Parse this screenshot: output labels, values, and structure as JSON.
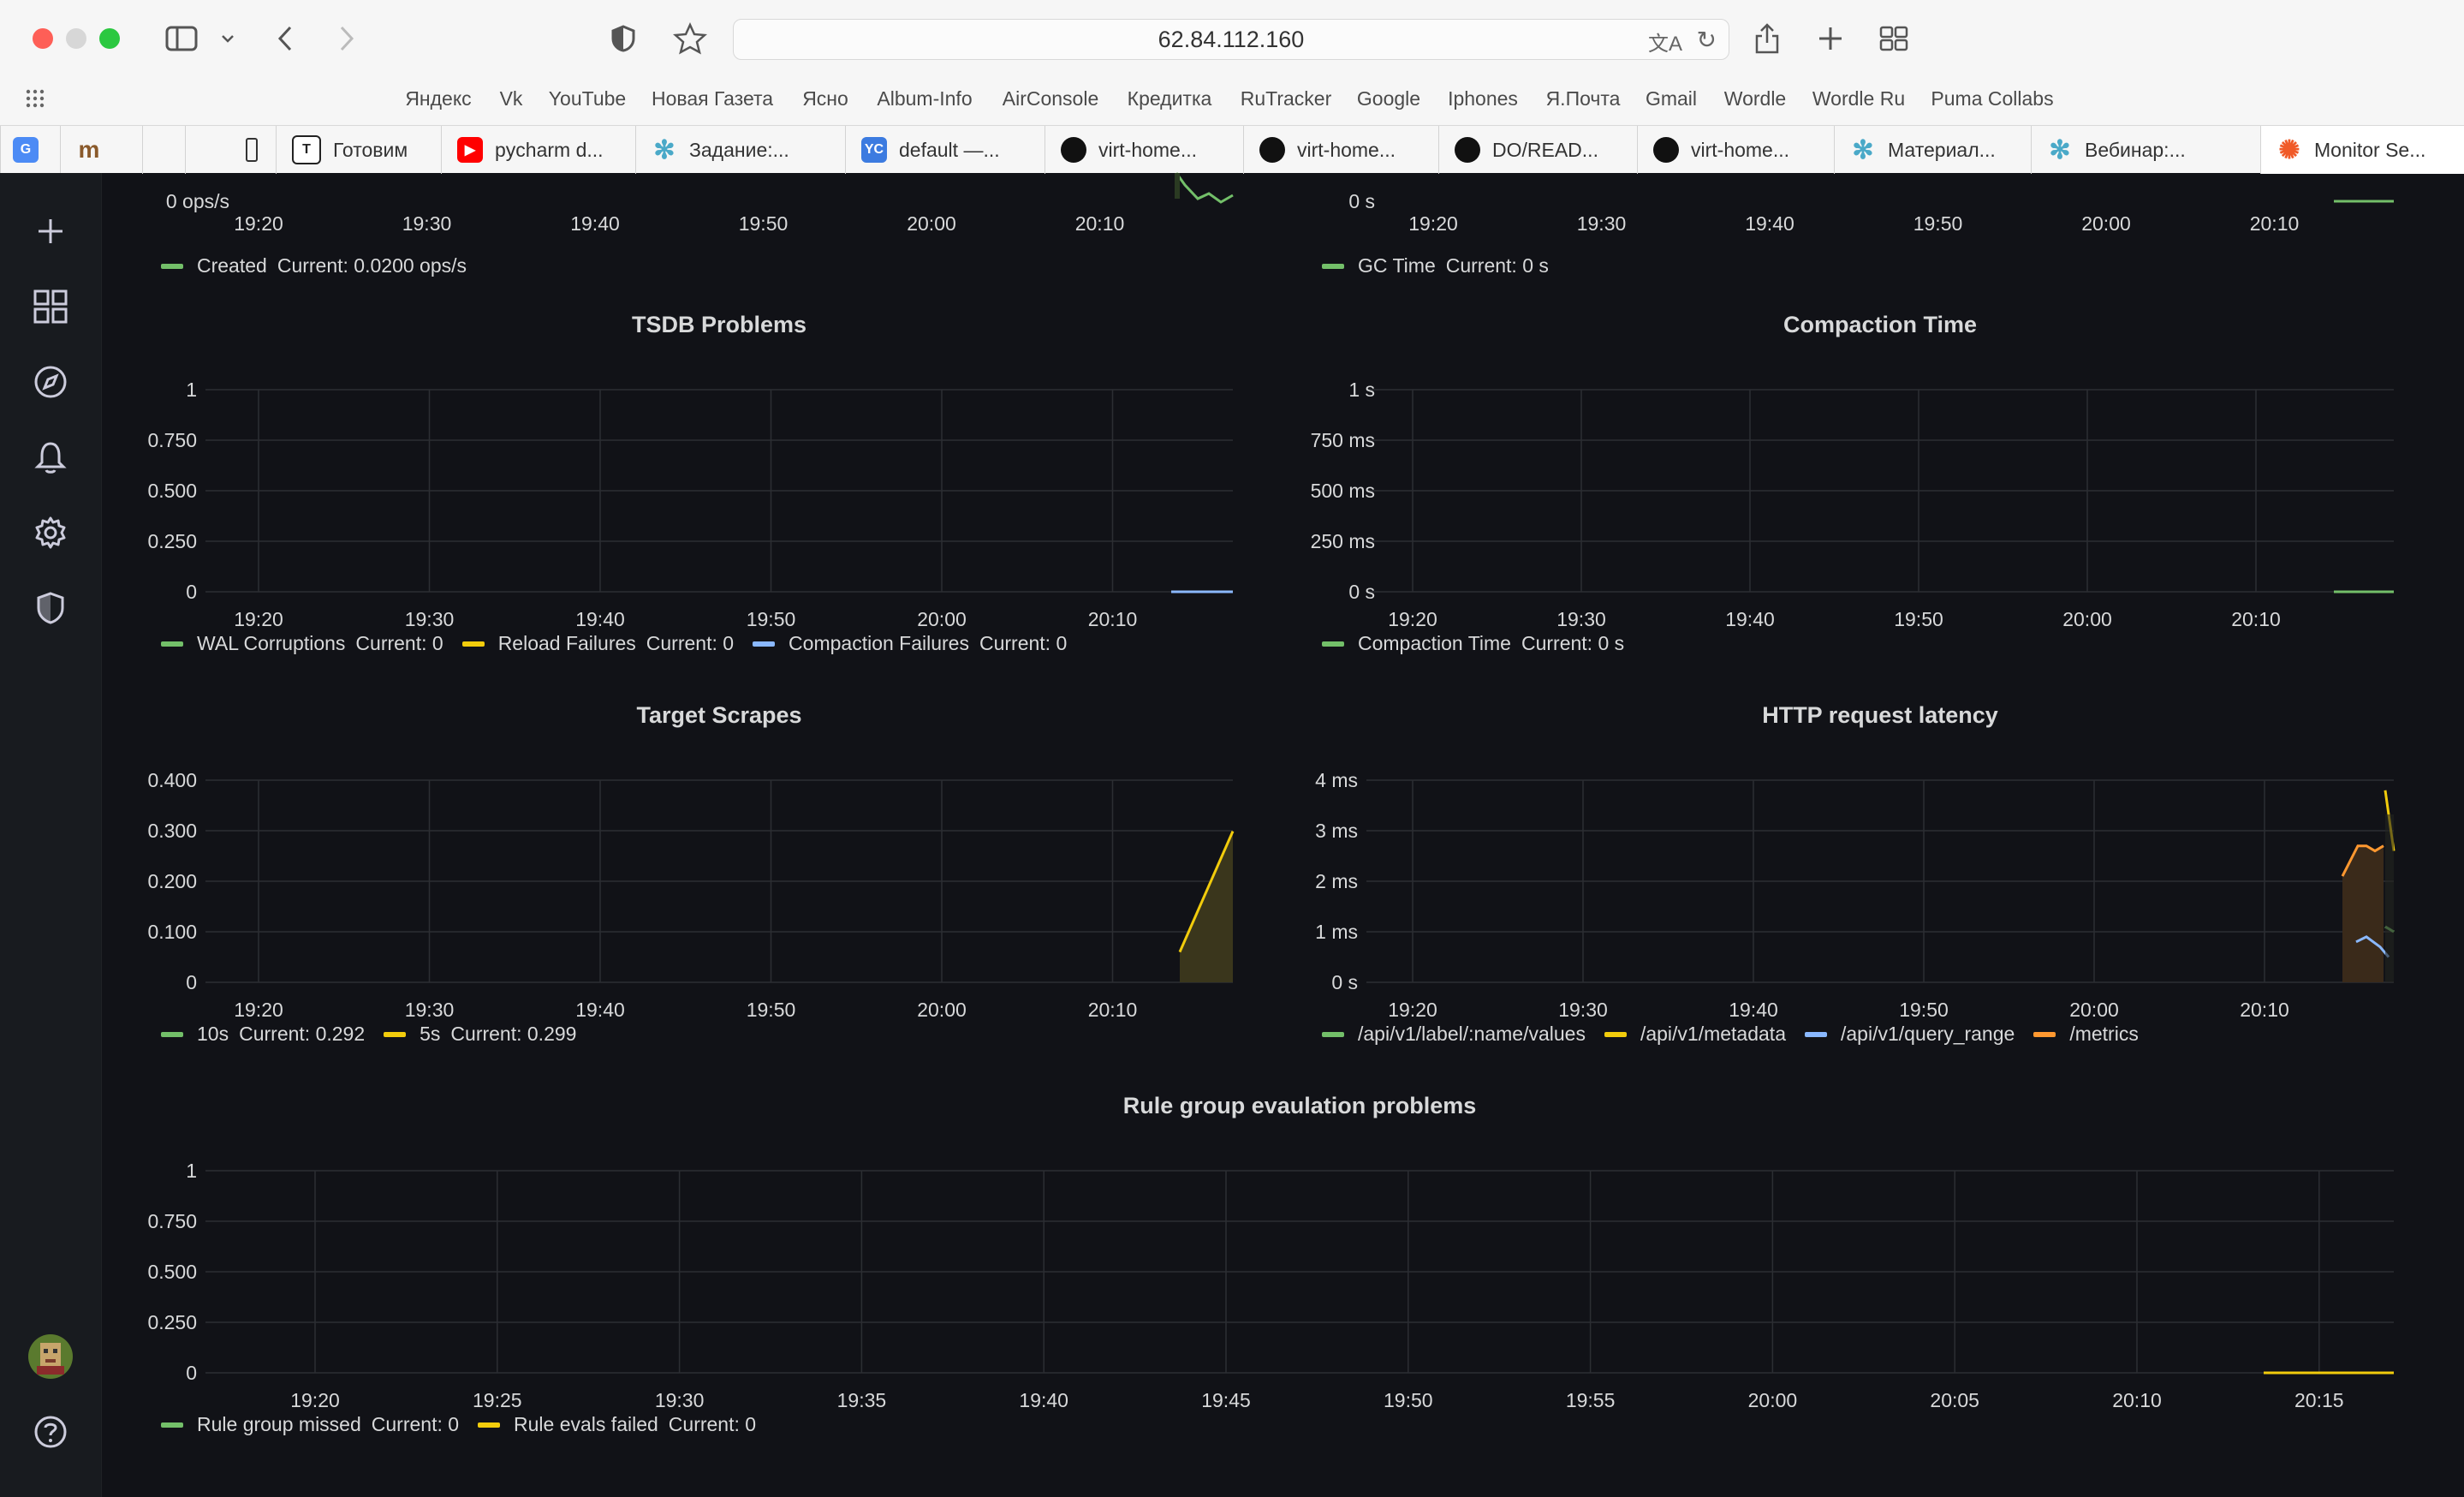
{
  "browser": {
    "url": "62.84.112.160",
    "bookmarks": [
      "Яндекс",
      "Vk",
      "YouTube",
      "Новая Газета",
      "Ясно",
      "Album-Info",
      "AirConsole",
      "Кредитка",
      "RuTracker",
      "Google",
      "Iphones",
      "Я.Почта",
      "Gmail",
      "Wordle",
      "Wordle Ru",
      "Puma Collabs"
    ],
    "tabs": [
      {
        "label": "Готовим",
        "icon": "tinkoff-icon"
      },
      {
        "label": "pycharm d...",
        "icon": "youtube-icon"
      },
      {
        "label": "Задание:...",
        "icon": "flower-icon"
      },
      {
        "label": "default —...",
        "icon": "yc-icon"
      },
      {
        "label": "virt-home...",
        "icon": "github-icon"
      },
      {
        "label": "virt-home...",
        "icon": "github-icon"
      },
      {
        "label": "DO/READ...",
        "icon": "github-icon"
      },
      {
        "label": "virt-home...",
        "icon": "github-icon"
      },
      {
        "label": "Материал...",
        "icon": "flower-icon"
      },
      {
        "label": "Вебинар:...",
        "icon": "flower-icon"
      },
      {
        "label": "Monitor Se...",
        "icon": "grafana-icon"
      }
    ],
    "yc_badge": "YC"
  },
  "colors": {
    "green": "#73bf69",
    "yellow": "#f2cc0c",
    "blue": "#8ab8ff",
    "orange": "#ff9830",
    "lightblue": "#5794f2"
  },
  "panels": {
    "top_left": {
      "y_bottom_label": "0 ops/s",
      "x_ticks": [
        "19:20",
        "19:30",
        "19:40",
        "19:50",
        "20:00",
        "20:10"
      ],
      "legend": [
        {
          "name": "Created",
          "current": "Current: 0.0200 ops/s",
          "color": "#73bf69"
        }
      ]
    },
    "top_right": {
      "y_bottom_label": "0 s",
      "x_ticks": [
        "19:20",
        "19:30",
        "19:40",
        "19:50",
        "20:00",
        "20:10"
      ],
      "legend": [
        {
          "name": "GC Time",
          "current": "Current: 0 s",
          "color": "#73bf69"
        }
      ]
    },
    "tsdb": {
      "title": "TSDB Problems",
      "y_ticks": [
        "1",
        "0.750",
        "0.500",
        "0.250",
        "0"
      ],
      "x_ticks": [
        "19:20",
        "19:30",
        "19:40",
        "19:50",
        "20:00",
        "20:10"
      ],
      "legend": [
        {
          "name": "WAL Corruptions",
          "current": "Current: 0",
          "color": "#73bf69"
        },
        {
          "name": "Reload Failures",
          "current": "Current: 0",
          "color": "#f2cc0c"
        },
        {
          "name": "Compaction Failures",
          "current": "Current: 0",
          "color": "#8ab8ff"
        }
      ]
    },
    "compaction": {
      "title": "Compaction Time",
      "y_ticks": [
        "1 s",
        "750 ms",
        "500 ms",
        "250 ms",
        "0 s"
      ],
      "x_ticks": [
        "19:20",
        "19:30",
        "19:40",
        "19:50",
        "20:00",
        "20:10"
      ],
      "legend": [
        {
          "name": "Compaction Time",
          "current": "Current: 0 s",
          "color": "#73bf69"
        }
      ]
    },
    "scrapes": {
      "title": "Target Scrapes",
      "y_ticks": [
        "0.400",
        "0.300",
        "0.200",
        "0.100",
        "0"
      ],
      "x_ticks": [
        "19:20",
        "19:30",
        "19:40",
        "19:50",
        "20:00",
        "20:10"
      ],
      "legend": [
        {
          "name": "10s",
          "current": "Current: 0.292",
          "color": "#73bf69"
        },
        {
          "name": "5s",
          "current": "Current: 0.299",
          "color": "#f2cc0c"
        }
      ]
    },
    "latency": {
      "title": "HTTP request latency",
      "y_ticks": [
        "4 ms",
        "3 ms",
        "2 ms",
        "1 ms",
        "0 s"
      ],
      "x_ticks": [
        "19:20",
        "19:30",
        "19:40",
        "19:50",
        "20:00",
        "20:10"
      ],
      "legend": [
        {
          "name": "/api/v1/label/:name/values",
          "current": "",
          "color": "#73bf69"
        },
        {
          "name": "/api/v1/metadata",
          "current": "",
          "color": "#f2cc0c"
        },
        {
          "name": "/api/v1/query_range",
          "current": "",
          "color": "#8ab8ff"
        },
        {
          "name": "/metrics",
          "current": "",
          "color": "#ff9830"
        }
      ]
    },
    "rules": {
      "title": "Rule group evaulation problems",
      "y_ticks": [
        "1",
        "0.750",
        "0.500",
        "0.250",
        "0"
      ],
      "x_ticks": [
        "19:20",
        "19:25",
        "19:30",
        "19:35",
        "19:40",
        "19:45",
        "19:50",
        "19:55",
        "20:00",
        "20:05",
        "20:10",
        "20:15"
      ],
      "legend": [
        {
          "name": "Rule group missed",
          "current": "Current: 0",
          "color": "#73bf69"
        },
        {
          "name": "Rule evals failed",
          "current": "Current: 0",
          "color": "#f2cc0c"
        }
      ]
    }
  },
  "chart_data": [
    {
      "type": "line",
      "title": "TSDB Problems",
      "ylim": [
        0,
        1
      ],
      "series": [
        {
          "name": "WAL Corruptions",
          "values": [
            0,
            0
          ]
        },
        {
          "name": "Reload Failures",
          "values": [
            0,
            0
          ]
        },
        {
          "name": "Compaction Failures",
          "values": [
            0,
            0
          ]
        }
      ]
    },
    {
      "type": "line",
      "title": "Compaction Time",
      "ylim": [
        0,
        1
      ],
      "series": [
        {
          "name": "Compaction Time",
          "values": [
            0,
            0
          ]
        }
      ]
    },
    {
      "type": "area",
      "title": "Target Scrapes",
      "ylim": [
        0,
        0.4
      ],
      "series": [
        {
          "name": "10s",
          "values": [
            0.06,
            0.292
          ]
        },
        {
          "name": "5s",
          "values": [
            0.06,
            0.299
          ]
        }
      ]
    },
    {
      "type": "line",
      "title": "HTTP request latency",
      "ylim": [
        0,
        4
      ],
      "series": [
        {
          "name": "/metrics",
          "values": [
            2.1,
            2.7,
            2.7,
            2.6,
            2.7
          ]
        },
        {
          "name": "/api/v1/metadata",
          "values": [
            3.8,
            2.6
          ]
        },
        {
          "name": "/api/v1/query_range",
          "values": [
            0.8,
            0.9,
            0.7,
            0.5
          ]
        },
        {
          "name": "/api/v1/label/:name/values",
          "values": [
            1.1,
            1.0
          ]
        }
      ]
    },
    {
      "type": "line",
      "title": "Rule group evaulation problems",
      "ylim": [
        0,
        1
      ],
      "series": [
        {
          "name": "Rule group missed",
          "values": [
            0,
            0
          ]
        },
        {
          "name": "Rule evals failed",
          "values": [
            0,
            0
          ]
        }
      ]
    }
  ]
}
